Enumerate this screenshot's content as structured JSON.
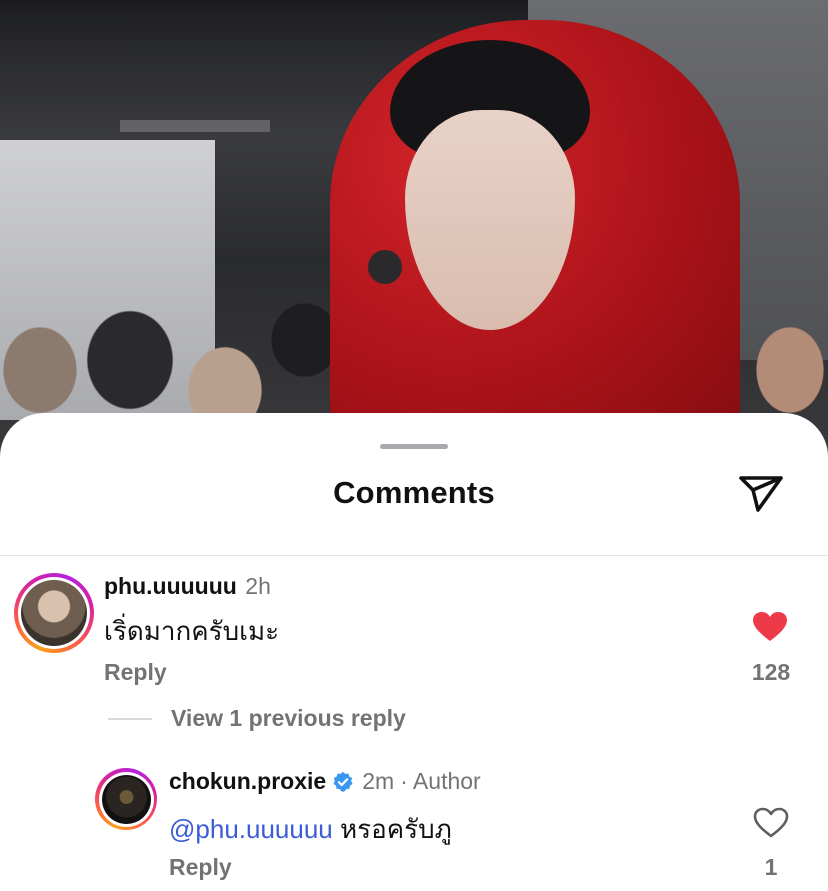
{
  "sheet": {
    "title": "Comments"
  },
  "comments": [
    {
      "username": "phu.uuuuuu",
      "time": "2h",
      "text": "เริ่ดมากครับเมะ",
      "reply_label": "Reply",
      "likes": "128",
      "liked": true,
      "view_replies": "View 1 previous reply"
    }
  ],
  "replies": [
    {
      "username": "chokun.proxie",
      "verified": true,
      "time": "2m",
      "author_tag": "· Author",
      "mention": "@phu.uuuuuu",
      "text": "หรอครับภู",
      "reply_label": "Reply",
      "likes": "1",
      "liked": false
    }
  ],
  "icons": {
    "share": "paper-plane-icon",
    "liked": "heart-filled-icon",
    "unliked": "heart-outline-icon",
    "verified": "verified-badge-icon"
  },
  "colors": {
    "heart": "#ed3a48",
    "verified": "#3897f0",
    "mention": "#3b5cd6",
    "muted": "#737373"
  }
}
